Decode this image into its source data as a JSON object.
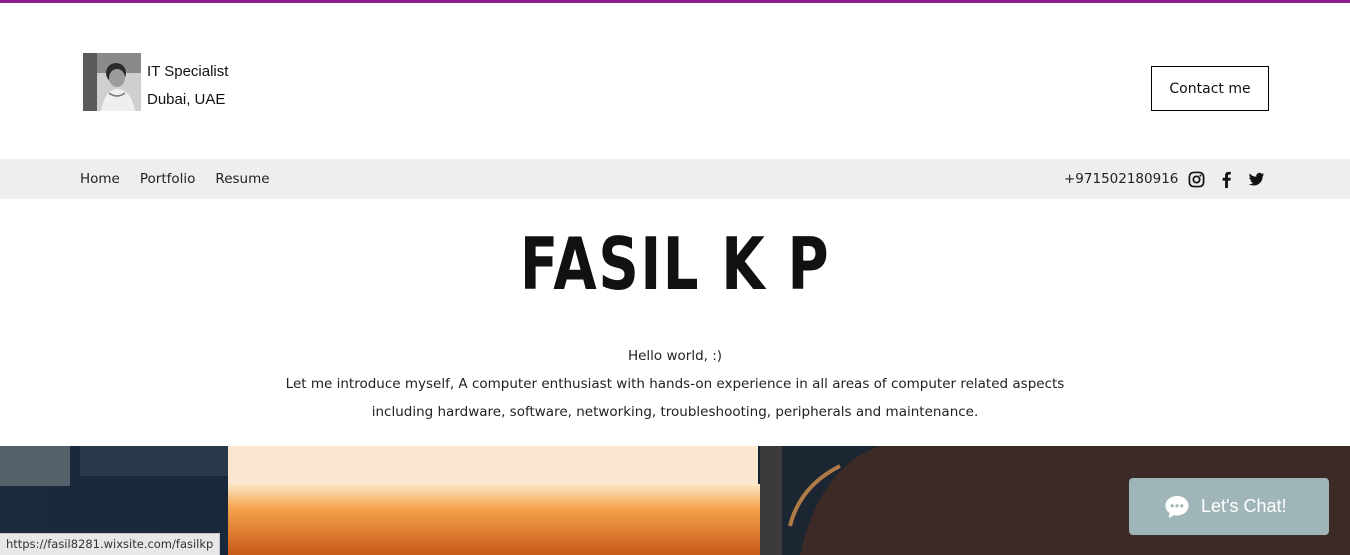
{
  "header": {
    "role": "IT Specialist",
    "location": "Dubai, UAE",
    "contact_label": "Contact me"
  },
  "nav": {
    "items": [
      {
        "label": "Home"
      },
      {
        "label": "Portfolio"
      },
      {
        "label": "Resume"
      }
    ],
    "phone": "+971502180916",
    "socials": [
      "instagram-icon",
      "facebook-icon",
      "twitter-icon"
    ]
  },
  "hero": {
    "name": "FASIL K P",
    "intro_lines": [
      "Hello  world, :)",
      "Let me introduce myself, A computer enthusiast with hands-on experience in all areas of computer related aspects",
      "including hardware, software, networking, troubleshooting, peripherals and maintenance."
    ]
  },
  "status_bar": {
    "url": "https://fasil8281.wixsite.com/fasilkp"
  },
  "chat": {
    "label": "Let's Chat!"
  },
  "colors": {
    "accent": "#8e1f8b",
    "nav_bg": "#eeeeee",
    "chat_bg": "#a0b5b8"
  }
}
